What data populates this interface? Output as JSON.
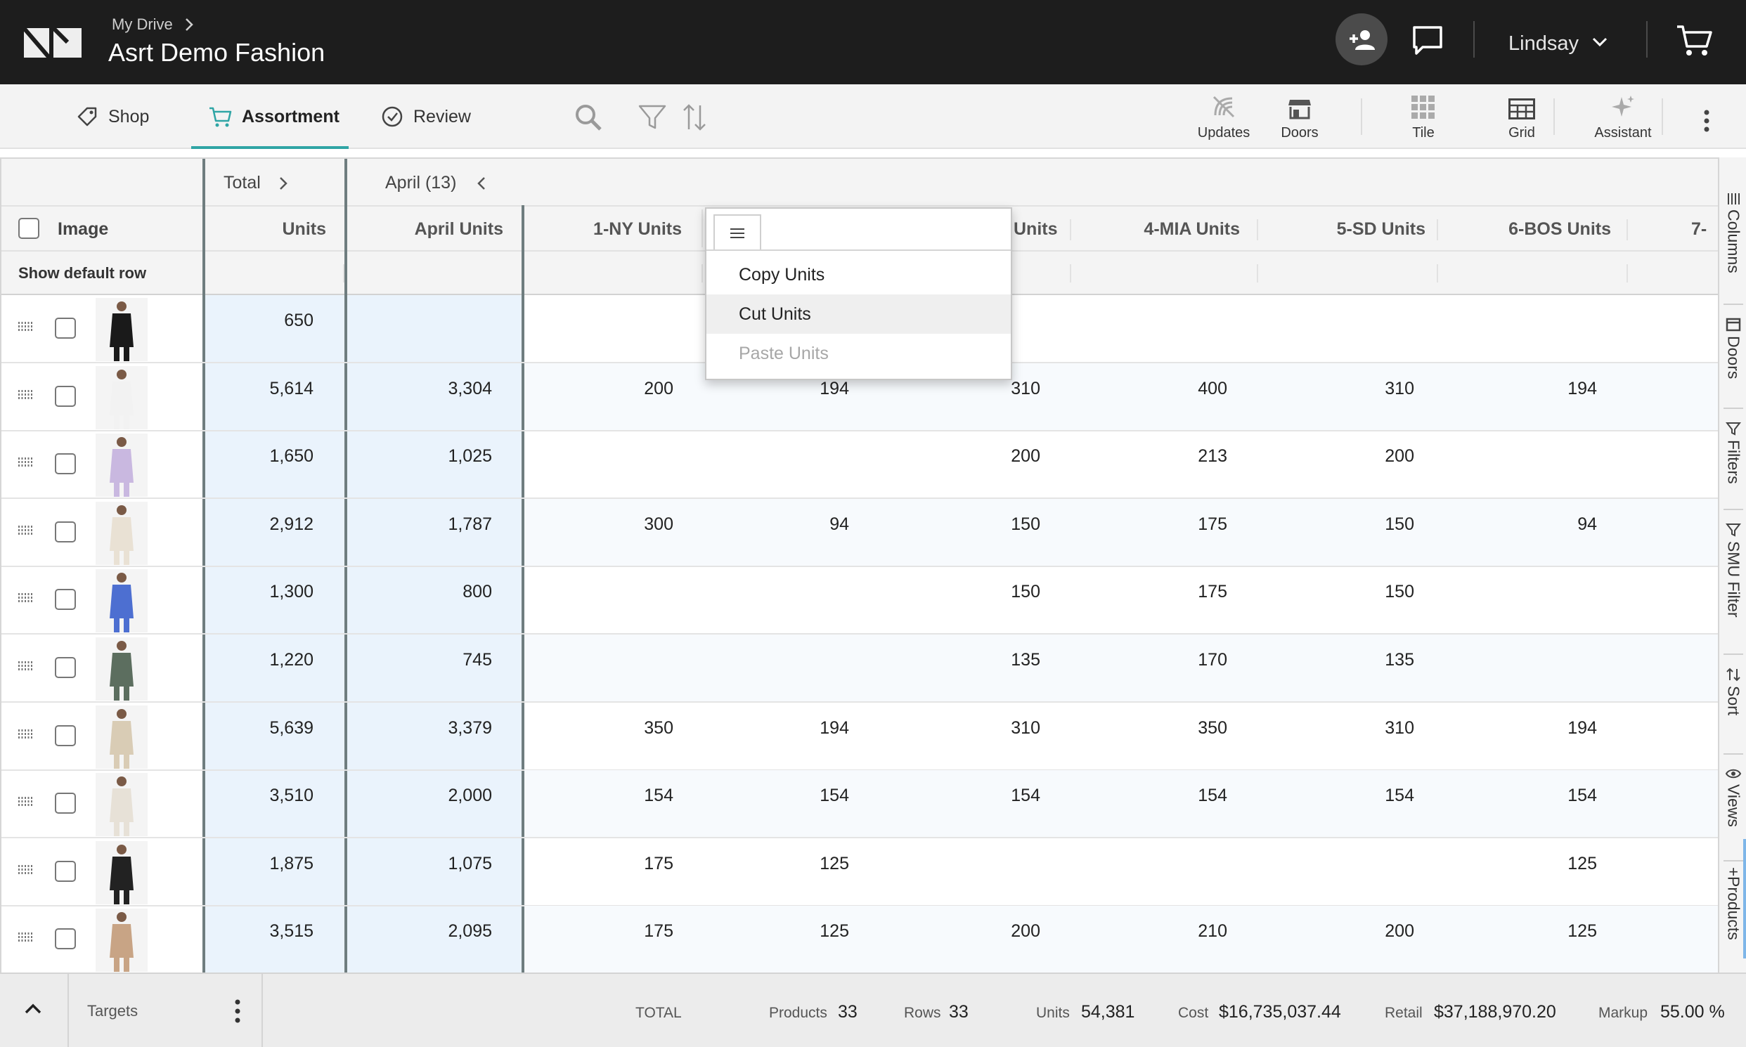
{
  "breadcrumb": {
    "parent": "My Drive",
    "title": "Asrt Demo Fashion"
  },
  "user": {
    "name": "Lindsay"
  },
  "tabs": [
    {
      "label": "Shop",
      "icon": "tag-icon"
    },
    {
      "label": "Assortment",
      "icon": "cart-icon",
      "active": true
    },
    {
      "label": "Review",
      "icon": "check-circle-icon"
    }
  ],
  "toolbar_right": [
    {
      "label": "Updates",
      "icon": "updates-icon"
    },
    {
      "label": "Doors",
      "icon": "store-icon"
    },
    {
      "label": "Tile",
      "icon": "tile-icon"
    },
    {
      "label": "Grid",
      "icon": "grid-icon"
    },
    {
      "label": "Assistant",
      "icon": "sparkle-icon"
    }
  ],
  "grid": {
    "group_headers": {
      "total": "Total",
      "april": "April (13)"
    },
    "columns": {
      "image": "Image",
      "units": "Units",
      "april_units": "April Units",
      "ny": "1-NY Units",
      "hidden": "Units",
      "mia": "4-MIA Units",
      "sd": "5-SD Units",
      "bos": "6-BOS Units",
      "next": "7-"
    },
    "default_row_label": "Show default row",
    "rows": [
      {
        "units": "650",
        "april": "",
        "ny": "",
        "c2": "",
        "c3": "",
        "mia": "",
        "sd": "",
        "bos": "",
        "img": "#1a1a1a"
      },
      {
        "units": "5,614",
        "april": "3,304",
        "ny": "200",
        "c2": "194",
        "c3": "310",
        "mia": "400",
        "sd": "310",
        "bos": "194",
        "img": "#f2f2f2"
      },
      {
        "units": "1,650",
        "april": "1,025",
        "ny": "",
        "c2": "",
        "c3": "200",
        "mia": "213",
        "sd": "200",
        "bos": "",
        "img": "#c9b8e0"
      },
      {
        "units": "2,912",
        "april": "1,787",
        "ny": "300",
        "c2": "94",
        "c3": "150",
        "mia": "175",
        "sd": "150",
        "bos": "94",
        "img": "#e9e1d4"
      },
      {
        "units": "1,300",
        "april": "800",
        "ny": "",
        "c2": "",
        "c3": "150",
        "mia": "175",
        "sd": "150",
        "bos": "",
        "img": "#4d6fd1"
      },
      {
        "units": "1,220",
        "april": "745",
        "ny": "",
        "c2": "",
        "c3": "135",
        "mia": "170",
        "sd": "135",
        "bos": "",
        "img": "#5c6e5f"
      },
      {
        "units": "5,639",
        "april": "3,379",
        "ny": "350",
        "c2": "194",
        "c3": "310",
        "mia": "350",
        "sd": "310",
        "bos": "194",
        "img": "#d9ccb5"
      },
      {
        "units": "3,510",
        "april": "2,000",
        "ny": "154",
        "c2": "154",
        "c3": "154",
        "mia": "154",
        "sd": "154",
        "bos": "154",
        "img": "#e7e1d7"
      },
      {
        "units": "1,875",
        "april": "1,075",
        "ny": "175",
        "c2": "125",
        "c3": "",
        "mia": "",
        "sd": "",
        "bos": "125",
        "img": "#222222"
      },
      {
        "units": "3,515",
        "april": "2,095",
        "ny": "175",
        "c2": "125",
        "c3": "200",
        "mia": "210",
        "sd": "200",
        "bos": "125",
        "img": "#c8a485"
      }
    ]
  },
  "context_menu": {
    "items": [
      "Copy Units",
      "Cut Units",
      "Paste Units"
    ]
  },
  "side_panel": [
    "Columns",
    "Doors",
    "Filters",
    "SMU Filter",
    "Sort",
    "Views",
    "Products"
  ],
  "footer": {
    "targets": "Targets",
    "total": "TOTAL",
    "products_label": "Products",
    "products": "33",
    "rows_label": "Rows",
    "rows": "33",
    "units_label": "Units",
    "units": "54,381",
    "cost_label": "Cost",
    "cost": "$16,735,037.44",
    "retail_label": "Retail",
    "retail": "$37,188,970.20",
    "markup_label": "Markup",
    "markup": "55.00 %"
  },
  "colors": {
    "accent": "#2fa5a5",
    "topbar": "#1d1d1d",
    "highlight_col": "#eaf3fc"
  }
}
